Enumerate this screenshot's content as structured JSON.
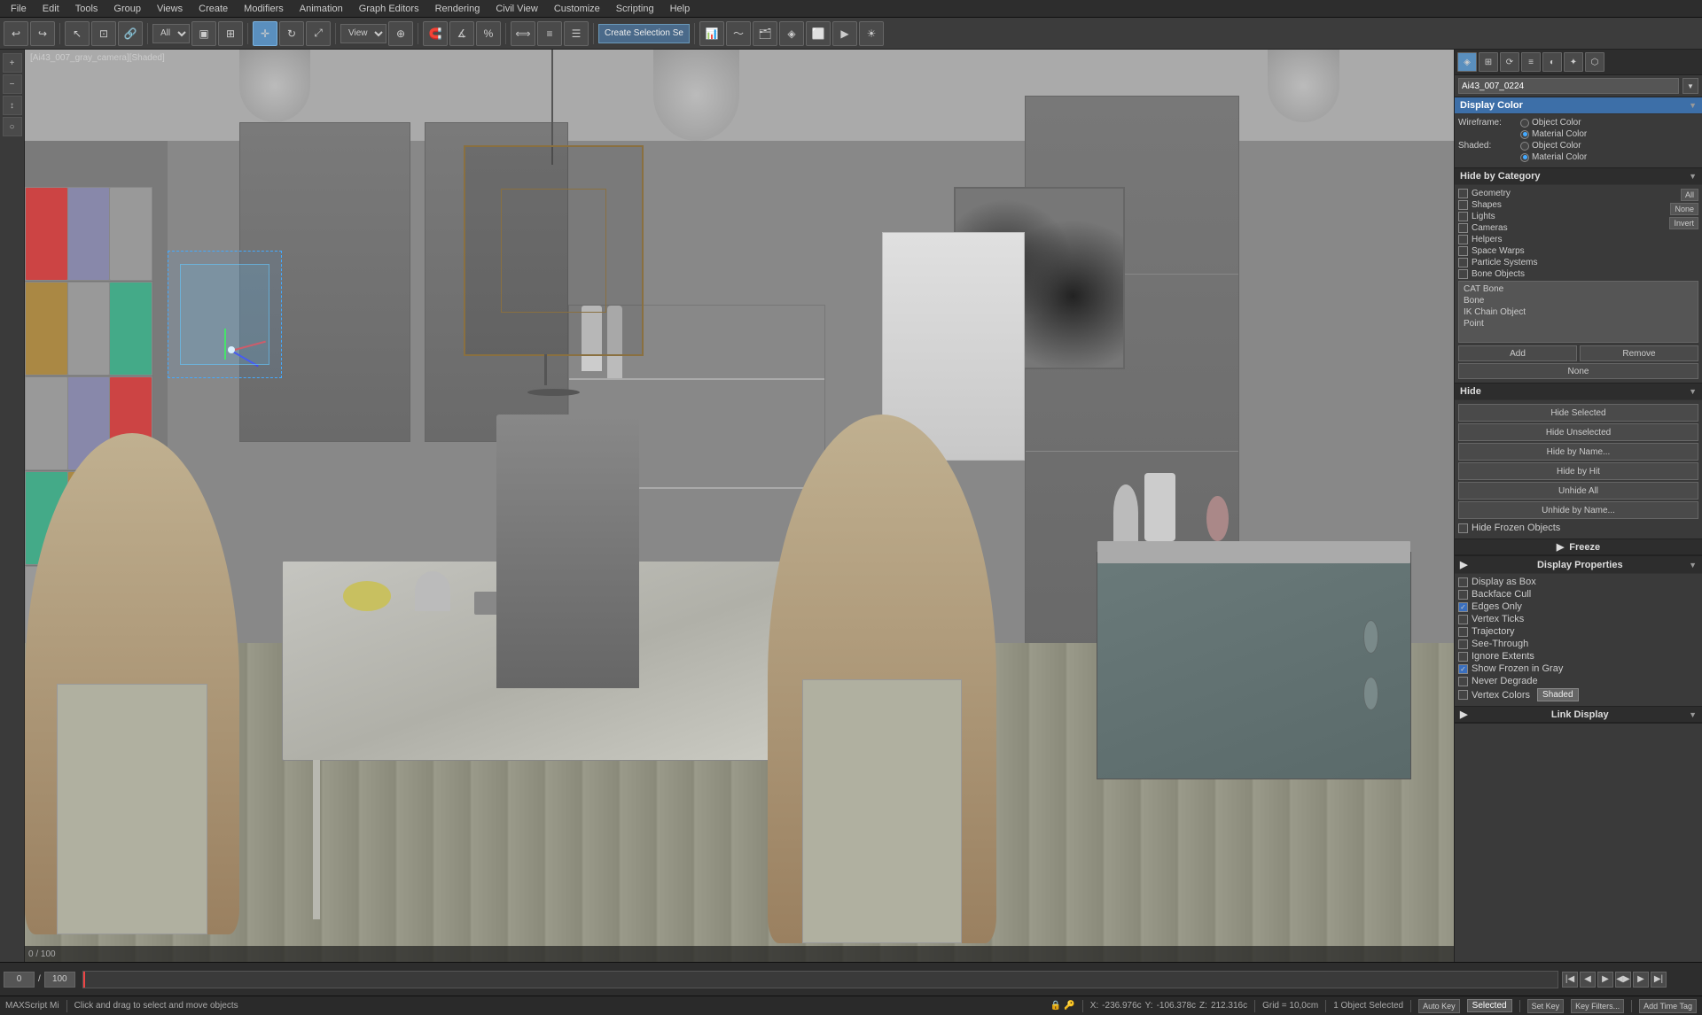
{
  "menubar": {
    "items": [
      "File",
      "Edit",
      "Tools",
      "Group",
      "Views",
      "Create",
      "Modifiers",
      "Animation",
      "Graph Editors",
      "Rendering",
      "Civil View",
      "Customize",
      "Scripting",
      "Help"
    ]
  },
  "toolbar": {
    "create_selection_label": "Create Selection Se",
    "view_label": "View",
    "filter_label": "All"
  },
  "viewport": {
    "label": "[Ai43_007_gray_camera][Shaded]",
    "hint_text": "Click and drag to select and move objects"
  },
  "right_panel": {
    "object_name": "Ai43_007_0224",
    "sections": {
      "display_color": {
        "title": "Display Color",
        "wireframe": {
          "label": "Wireframe:",
          "options": [
            "Object Color",
            "Material Color"
          ],
          "selected": "Material Color"
        },
        "shaded": {
          "label": "Shaded:",
          "options": [
            "Object Color",
            "Material Color"
          ],
          "selected": "Material Color"
        }
      },
      "hide_by_category": {
        "title": "Hide by Category",
        "categories": [
          {
            "label": "Geometry",
            "checked": false
          },
          {
            "label": "Shapes",
            "checked": false
          },
          {
            "label": "Lights",
            "checked": false
          },
          {
            "label": "Cameras",
            "checked": false
          },
          {
            "label": "Helpers",
            "checked": false
          },
          {
            "label": "Space Warps",
            "checked": false
          },
          {
            "label": "Particle Systems",
            "checked": false
          },
          {
            "label": "Bone Objects",
            "checked": false
          }
        ],
        "buttons": {
          "all": "All",
          "none": "None",
          "invert": "Invert"
        },
        "list_items": [
          "CAT Bone",
          "Bone",
          "IK Chain Object",
          "Point"
        ]
      },
      "hide": {
        "title": "Hide",
        "buttons": [
          "Hide Selected",
          "Hide Unselected",
          "Hide by Name...",
          "Hide by Hit",
          "Unhide All",
          "Unhide by Name..."
        ],
        "checkbox_label": "Hide Frozen Objects",
        "checkbox_checked": false
      },
      "freeze": {
        "title": "Freeze"
      },
      "display_properties": {
        "title": "Display Properties",
        "properties": [
          {
            "label": "Display as Box",
            "checked": false
          },
          {
            "label": "Backface Cull",
            "checked": false
          },
          {
            "label": "Edges Only",
            "checked": true
          },
          {
            "label": "Vertex Ticks",
            "checked": false
          },
          {
            "label": "Trajectory",
            "checked": false
          },
          {
            "label": "See-Through",
            "checked": false
          },
          {
            "label": "Ignore Extents",
            "checked": false
          },
          {
            "label": "Show Frozen in Gray",
            "checked": true
          },
          {
            "label": "Never Degrade",
            "checked": false
          },
          {
            "label": "Vertex Colors",
            "checked": false
          }
        ],
        "vertex_colors_badge": "Shaded"
      },
      "link_display": {
        "title": "Link Display"
      }
    }
  },
  "timeline": {
    "current_frame": "0",
    "total_frames": "100",
    "frame_display": "0 / 100"
  },
  "status_bar": {
    "script_label": "MAXScript Mi",
    "hint_text": "Click and drag to select and move objects",
    "coords": {
      "x_label": "X:",
      "x_value": "-236.976c",
      "y_label": "Y:",
      "y_value": "-106.378c",
      "z_label": "Z:",
      "z_value": "212.316c"
    },
    "grid_label": "Grid = 10,0cm",
    "selection_label": "1 Object Selected",
    "auto_key_label": "Auto Key",
    "selected_label": "Selected",
    "set_key_label": "Set Key",
    "key_filters_label": "Key Filters...",
    "add_time_tag_label": "Add Time Tag"
  },
  "cmd_panel_icons": [
    "◆",
    "⊞",
    "⟳",
    "≡",
    "◐",
    "✦",
    "⬡"
  ],
  "chain_object_label": "Chain Object",
  "point_label": "Point"
}
